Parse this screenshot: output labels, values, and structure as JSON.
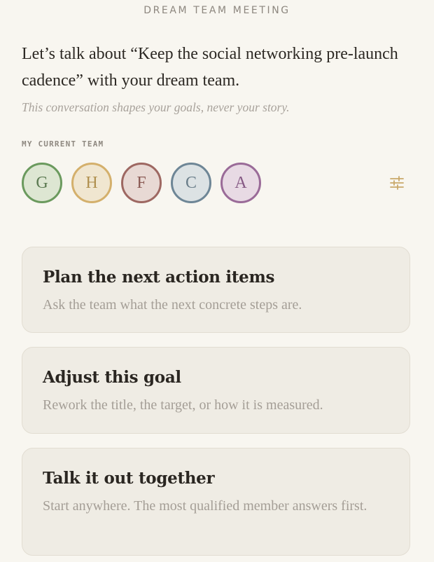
{
  "header": {
    "title": "DREAM TEAM MEETING"
  },
  "intro": {
    "text": "Let’s talk about “Keep the social networking pre-launch cadence” with your dream team.",
    "subtitle": "This conversation shapes your goals, never your story."
  },
  "team": {
    "label": "MY CURRENT TEAM",
    "members": [
      {
        "initial": "G",
        "border": "#6b9a5e",
        "fill": "#dde6d2",
        "text": "#5c7a52"
      },
      {
        "initial": "H",
        "border": "#d4b06c",
        "fill": "#f0e6d0",
        "text": "#b0904f"
      },
      {
        "initial": "F",
        "border": "#9e6862",
        "fill": "#e8d9d4",
        "text": "#8a5a54"
      },
      {
        "initial": "C",
        "border": "#6e8696",
        "fill": "#dce2e4",
        "text": "#6a7e8a"
      },
      {
        "initial": "A",
        "border": "#9a6b98",
        "fill": "#e8dae4",
        "text": "#865a85"
      }
    ],
    "settings_icon": "sliders-icon",
    "accent": "#c9a86a"
  },
  "options": [
    {
      "title": "Plan the next action items",
      "description": "Ask the team what the next concrete steps are."
    },
    {
      "title": "Adjust this goal",
      "description": "Rework the title, the target, or how it is measured."
    },
    {
      "title": "Talk it out together",
      "description": "Start anywhere. The most qualified member answers first."
    }
  ]
}
